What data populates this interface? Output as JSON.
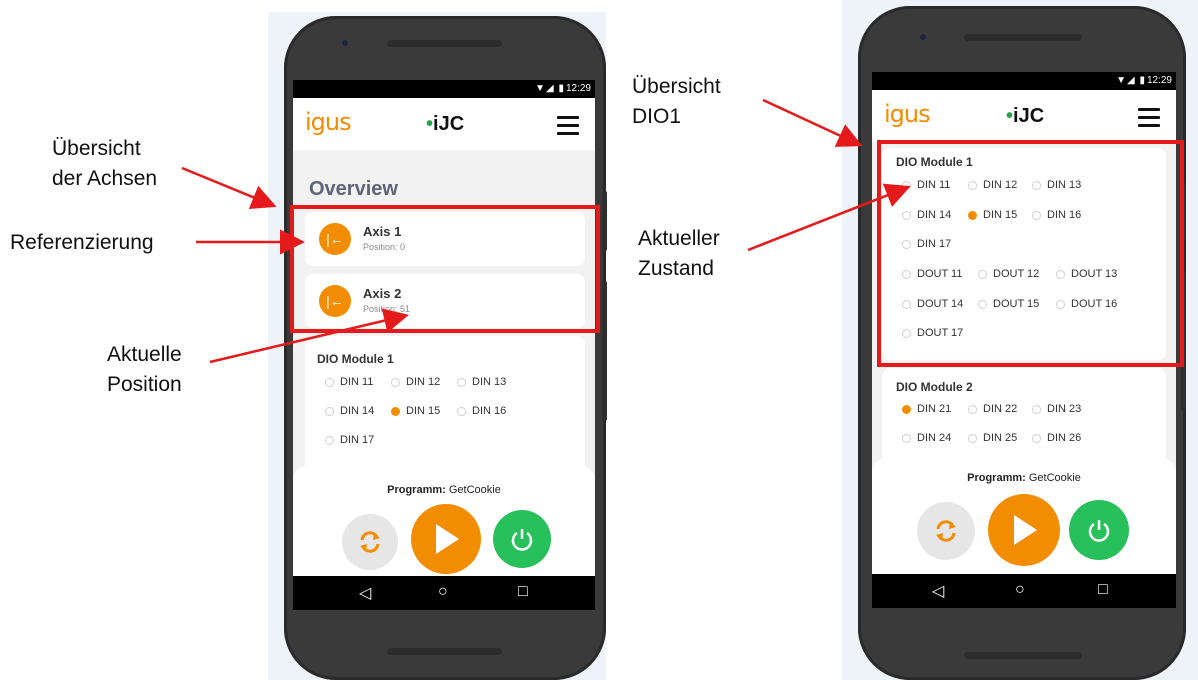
{
  "status_bar": {
    "icons": "▼◢ ▮",
    "time": "12:29"
  },
  "app": {
    "logo": "igus",
    "brand_dot": "•",
    "brand_name": "iJC"
  },
  "left_phone": {
    "overview_title": "Overview",
    "axes": [
      {
        "name": "Axis 1",
        "position": "Position: 0"
      },
      {
        "name": "Axis 2",
        "position": "Position: 51"
      }
    ],
    "dio1": {
      "title": "DIO Module 1",
      "din": [
        {
          "label": "DIN 11",
          "active": false
        },
        {
          "label": "DIN 12",
          "active": false
        },
        {
          "label": "DIN 13",
          "active": false
        },
        {
          "label": "DIN 14",
          "active": false
        },
        {
          "label": "DIN 15",
          "active": true
        },
        {
          "label": "DIN 16",
          "active": false
        },
        {
          "label": "DIN 17",
          "active": false
        }
      ]
    },
    "program_label": "Programm:",
    "program_name": "GetCookie"
  },
  "right_phone": {
    "dio1": {
      "title": "DIO Module 1",
      "din": [
        {
          "label": "DIN 11",
          "active": false
        },
        {
          "label": "DIN 12",
          "active": false
        },
        {
          "label": "DIN 13",
          "active": false
        },
        {
          "label": "DIN 14",
          "active": false
        },
        {
          "label": "DIN 15",
          "active": true
        },
        {
          "label": "DIN 16",
          "active": false
        },
        {
          "label": "DIN 17",
          "active": false
        }
      ],
      "dout": [
        {
          "label": "DOUT 11",
          "active": false
        },
        {
          "label": "DOUT 12",
          "active": false
        },
        {
          "label": "DOUT 13",
          "active": false
        },
        {
          "label": "DOUT 14",
          "active": false
        },
        {
          "label": "DOUT 15",
          "active": false
        },
        {
          "label": "DOUT 16",
          "active": false
        },
        {
          "label": "DOUT 17",
          "active": false
        }
      ]
    },
    "dio2": {
      "title": "DIO Module 2",
      "din": [
        {
          "label": "DIN 21",
          "active": true
        },
        {
          "label": "DIN 22",
          "active": false
        },
        {
          "label": "DIN 23",
          "active": false
        },
        {
          "label": "DIN 24",
          "active": false
        },
        {
          "label": "DIN 25",
          "active": false
        },
        {
          "label": "DIN 26",
          "active": false
        }
      ]
    },
    "program_label": "Programm:",
    "program_name": "GetCookie"
  },
  "controls": {
    "refresh_icon": "refresh-icon",
    "play_icon": "play-icon",
    "power_icon": "power-icon"
  },
  "nav_icons": {
    "back": "◁",
    "home": "○",
    "recent": "□"
  },
  "colors": {
    "accent": "#f28c00",
    "power": "#27c05a",
    "annotation_red": "#e51a1a",
    "refresh_bg": "#e6e6e6"
  },
  "annotations": {
    "uebersicht_achsen": [
      "Übersicht",
      "der Achsen"
    ],
    "referenzierung": "Referenzierung",
    "aktuelle_position": [
      "Aktuelle",
      "Position"
    ],
    "uebersicht_dio1": [
      "Übersicht",
      "DIO1"
    ],
    "aktueller_zustand": [
      "Aktueller",
      "Zustand"
    ]
  }
}
